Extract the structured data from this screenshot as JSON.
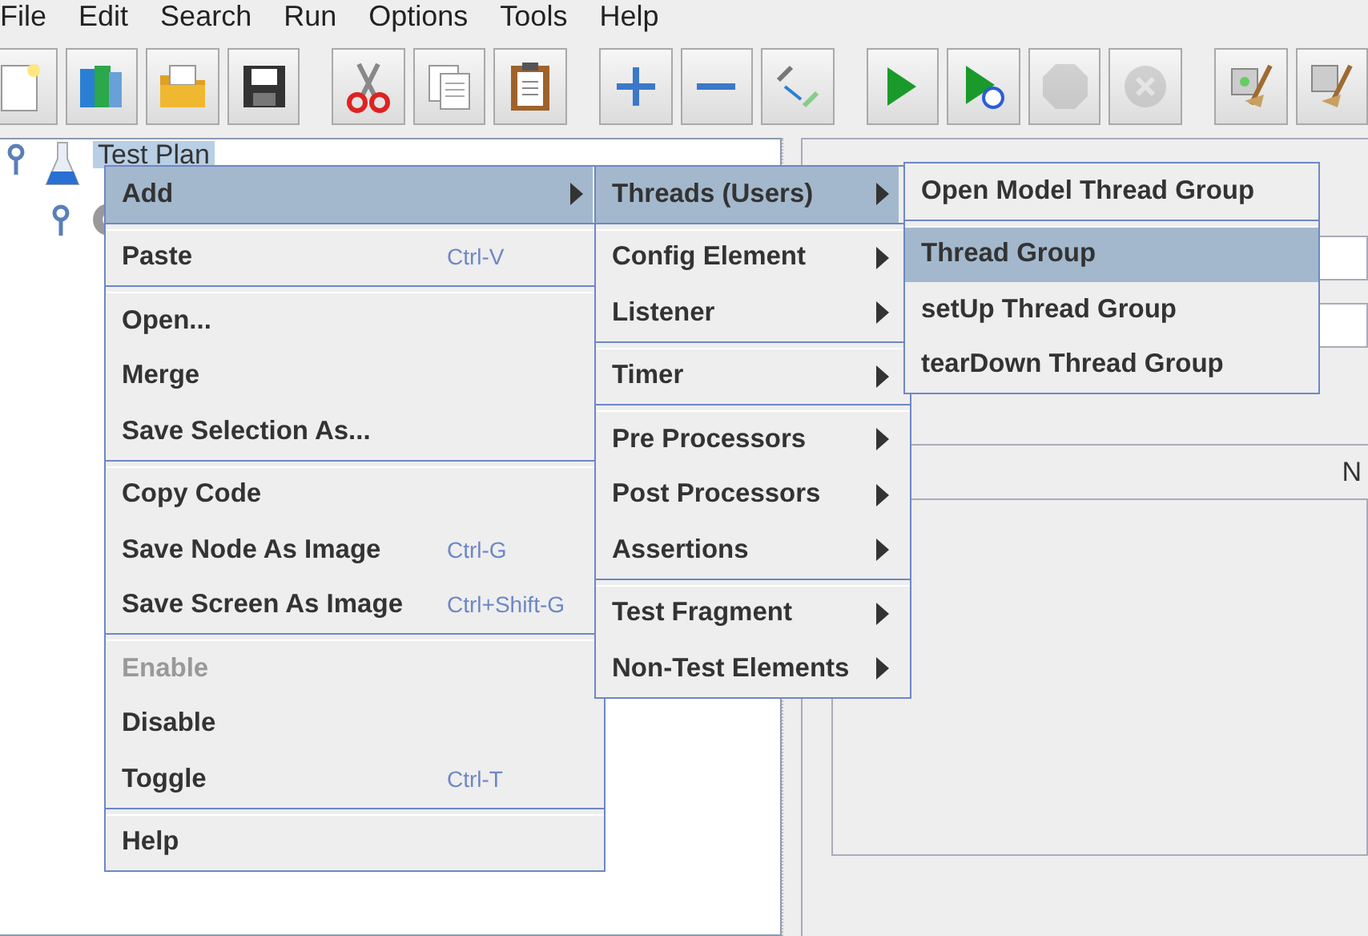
{
  "menubar": [
    {
      "label": "File"
    },
    {
      "label": "Edit"
    },
    {
      "label": "Search"
    },
    {
      "label": "Run"
    },
    {
      "label": "Options"
    },
    {
      "label": "Tools"
    },
    {
      "label": "Help"
    }
  ],
  "toolbar": [
    {
      "kind": "new",
      "disabled": false
    },
    {
      "kind": "templates",
      "disabled": false
    },
    {
      "kind": "open",
      "disabled": false
    },
    {
      "kind": "save",
      "disabled": false
    },
    {
      "kind": "gap"
    },
    {
      "kind": "cut",
      "disabled": false
    },
    {
      "kind": "copy",
      "disabled": false
    },
    {
      "kind": "paste",
      "disabled": false
    },
    {
      "kind": "gap"
    },
    {
      "kind": "expand",
      "disabled": false
    },
    {
      "kind": "collapse",
      "disabled": false
    },
    {
      "kind": "toggle",
      "disabled": false
    },
    {
      "kind": "gap"
    },
    {
      "kind": "start",
      "disabled": false
    },
    {
      "kind": "start_no_pause",
      "disabled": false
    },
    {
      "kind": "stop",
      "disabled": true
    },
    {
      "kind": "shutdown",
      "disabled": true
    },
    {
      "kind": "gap"
    },
    {
      "kind": "clear",
      "disabled": false
    },
    {
      "kind": "clear_all",
      "disabled": false
    }
  ],
  "tree": [
    {
      "label": "Test Plan",
      "selected": true,
      "kind": "plan",
      "children": [
        {
          "kind": "thread"
        }
      ]
    }
  ],
  "right_pane": {
    "column_header": "N"
  },
  "context_menu": [
    {
      "kind": "item",
      "label": "Add",
      "submenu": true,
      "selected": true,
      "disabled": false
    },
    {
      "kind": "separator"
    },
    {
      "kind": "item",
      "label": "Paste",
      "shortcut": "Ctrl-V",
      "submenu": false,
      "selected": false,
      "disabled": false
    },
    {
      "kind": "separator"
    },
    {
      "kind": "item",
      "label": "Open...",
      "submenu": false,
      "selected": false,
      "disabled": false
    },
    {
      "kind": "item",
      "label": "Merge",
      "submenu": false,
      "selected": false,
      "disabled": false
    },
    {
      "kind": "item",
      "label": "Save Selection As...",
      "submenu": false,
      "selected": false,
      "disabled": false
    },
    {
      "kind": "separator"
    },
    {
      "kind": "item",
      "label": "Copy Code",
      "submenu": false,
      "selected": false,
      "disabled": false
    },
    {
      "kind": "item",
      "label": "Save Node As Image",
      "shortcut": "Ctrl-G",
      "submenu": false,
      "selected": false,
      "disabled": false
    },
    {
      "kind": "item",
      "label": "Save Screen As Image",
      "shortcut": "Ctrl+Shift-G",
      "submenu": false,
      "selected": false,
      "disabled": false
    },
    {
      "kind": "separator"
    },
    {
      "kind": "item",
      "label": "Enable",
      "submenu": false,
      "selected": false,
      "disabled": true
    },
    {
      "kind": "item",
      "label": "Disable",
      "submenu": false,
      "selected": false,
      "disabled": false
    },
    {
      "kind": "item",
      "label": "Toggle",
      "shortcut": "Ctrl-T",
      "submenu": false,
      "selected": false,
      "disabled": false
    },
    {
      "kind": "separator"
    },
    {
      "kind": "item",
      "label": "Help",
      "submenu": false,
      "selected": false,
      "disabled": false
    }
  ],
  "add_submenu": [
    {
      "kind": "item",
      "label": "Threads (Users)",
      "submenu": true,
      "selected": true,
      "disabled": false
    },
    {
      "kind": "separator"
    },
    {
      "kind": "item",
      "label": "Config Element",
      "submenu": true,
      "selected": false,
      "disabled": false
    },
    {
      "kind": "item",
      "label": "Listener",
      "submenu": true,
      "selected": false,
      "disabled": false
    },
    {
      "kind": "separator"
    },
    {
      "kind": "item",
      "label": "Timer",
      "submenu": true,
      "selected": false,
      "disabled": false
    },
    {
      "kind": "separator"
    },
    {
      "kind": "item",
      "label": "Pre Processors",
      "submenu": true,
      "selected": false,
      "disabled": false
    },
    {
      "kind": "item",
      "label": "Post Processors",
      "submenu": true,
      "selected": false,
      "disabled": false
    },
    {
      "kind": "item",
      "label": "Assertions",
      "submenu": true,
      "selected": false,
      "disabled": false
    },
    {
      "kind": "separator"
    },
    {
      "kind": "item",
      "label": "Test Fragment",
      "submenu": true,
      "selected": false,
      "disabled": false
    },
    {
      "kind": "item",
      "label": "Non-Test Elements",
      "submenu": true,
      "selected": false,
      "disabled": false
    }
  ],
  "threads_submenu": [
    {
      "kind": "item",
      "label": "Open Model Thread Group",
      "submenu": false,
      "selected": false,
      "disabled": false
    },
    {
      "kind": "separator"
    },
    {
      "kind": "item",
      "label": "Thread Group",
      "submenu": false,
      "selected": true,
      "disabled": false
    },
    {
      "kind": "item",
      "label": "setUp Thread Group",
      "submenu": false,
      "selected": false,
      "disabled": false
    },
    {
      "kind": "item",
      "label": "tearDown Thread Group",
      "submenu": false,
      "selected": false,
      "disabled": false
    }
  ]
}
